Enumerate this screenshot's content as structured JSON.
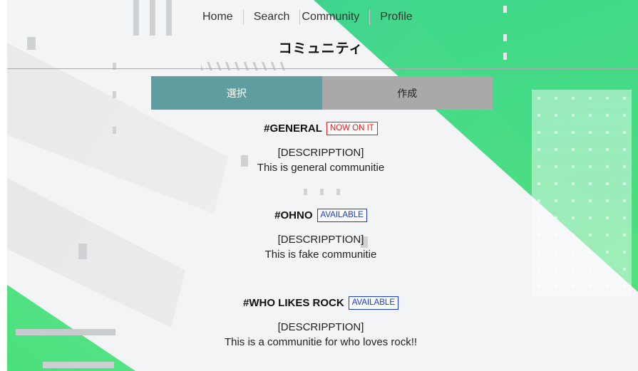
{
  "nav": {
    "items": [
      {
        "label": "Home"
      },
      {
        "label": "Search"
      },
      {
        "label": "Community"
      },
      {
        "label": "Profile"
      }
    ]
  },
  "page": {
    "title": "コミュニティ"
  },
  "tabs": {
    "select_label": "選択",
    "create_label": "作成"
  },
  "communities": [
    {
      "name": "#GENERAL",
      "status": "NOW ON IT",
      "status_type": "now",
      "desc_heading": "[DESCRIPPTION]",
      "description": "This is general communitie"
    },
    {
      "name": "#OHNO",
      "status": "AVAILABLE",
      "status_type": "available",
      "desc_heading": "[DESCRIPPTION]",
      "description": "This is fake communitie"
    },
    {
      "name": "#WHO LIKES ROCK",
      "status": "AVAILABLE",
      "status_type": "available",
      "desc_heading": "[DESCRIPPTION]",
      "description": "This is a communitie for who loves rock!!"
    }
  ],
  "colors": {
    "tab_select": "#5f9ea0",
    "tab_create": "#a9a9a9",
    "badge_now": "#e02020",
    "badge_available": "#1a3ad0",
    "accent_green": "#45d98b"
  }
}
